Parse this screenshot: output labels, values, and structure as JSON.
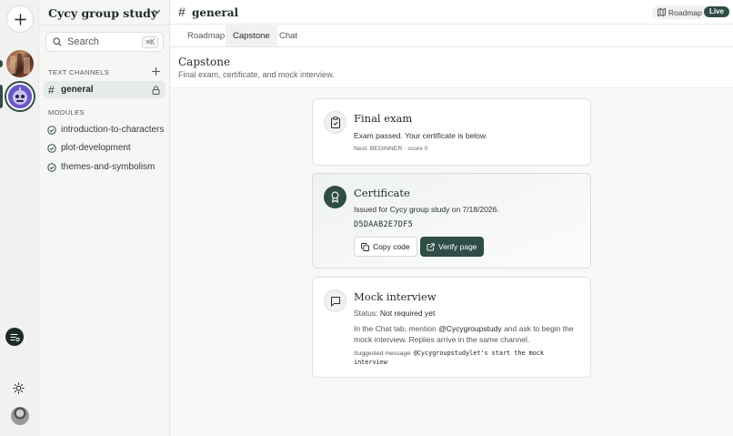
{
  "server": {
    "name": "Cycy group study"
  },
  "search": {
    "placeholder": "Search",
    "shortcut": "⌘K"
  },
  "sidebar": {
    "text_channels_label": "TEXT CHANNELS",
    "active_channel": "general",
    "modules_label": "MODULES",
    "modules": [
      {
        "label": "introduction-to-characters"
      },
      {
        "label": "plot-development"
      },
      {
        "label": "themes-and-symbolism"
      }
    ]
  },
  "header": {
    "channel": "general",
    "roadmap_label": "Roadmap",
    "live_badge": "Live"
  },
  "tabs": [
    {
      "label": "Roadmap"
    },
    {
      "label": "Capstone",
      "active": true
    },
    {
      "label": "Chat"
    }
  ],
  "page": {
    "title": "Capstone",
    "subtitle": "Final exam, certificate, and mock interview."
  },
  "final_exam": {
    "title": "Final exam",
    "status": "Exam passed. Your certificate is below.",
    "meta": "Nest: BEGINNER · score 0"
  },
  "certificate": {
    "title": "Certificate",
    "issued_prefix": "Issued for",
    "issued_for": "Cycy group study",
    "issued_suffix": "on 7/18/2026.",
    "code": "D5DAAB2E7DF5",
    "copy_label": "Copy code",
    "verify_label": "Verify page"
  },
  "mock_interview": {
    "title": "Mock interview",
    "status_label": "Status:",
    "status_value": "Not required yet",
    "instr_1": "In the Chat tab, mention",
    "mention": "@Cycygroupstudy",
    "instr_2": "and ask to begin the",
    "instr_3": "mock interview. Replies arrive in the same channel.",
    "suggested_label": "Suggested message:",
    "suggested_line1": "@Cycygroupstudylet's start the mock",
    "suggested_line2": "interview"
  },
  "colors": {
    "accent": "#2f4d46",
    "sidebar_bg": "#f6f6f4",
    "rail_bg": "#f1f1ef"
  }
}
